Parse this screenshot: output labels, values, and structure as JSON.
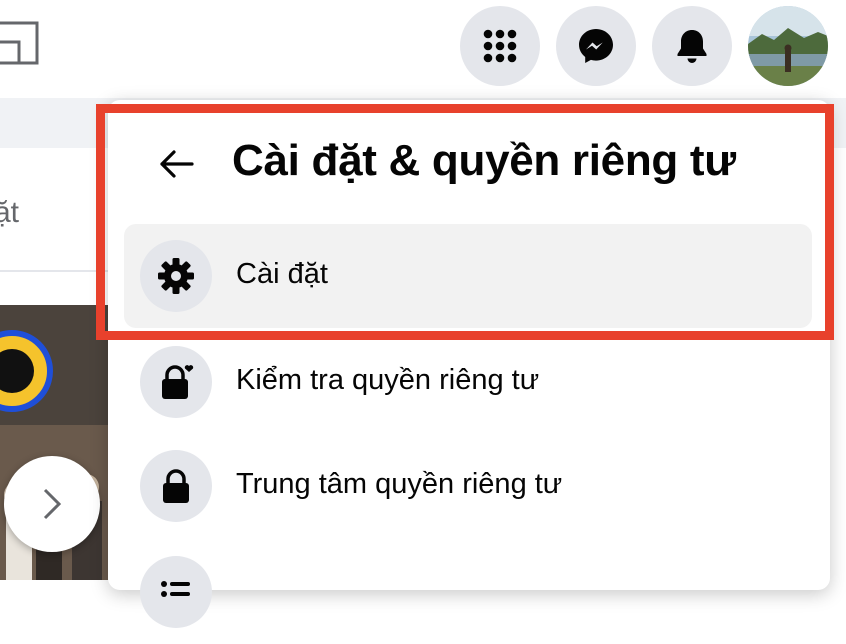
{
  "topbar": {
    "left_icon": "window-outline-icon",
    "buttons": [
      {
        "icon": "menu-grid-icon"
      },
      {
        "icon": "messenger-icon"
      },
      {
        "icon": "bell-icon"
      }
    ],
    "avatar": "profile-avatar"
  },
  "background": {
    "partial_text": "ặt"
  },
  "panel": {
    "back_icon": "arrow-left-icon",
    "title": "Cài đặt & quyền riêng tư",
    "items": [
      {
        "label": "Cài đặt",
        "icon": "gear-icon"
      },
      {
        "label": "Kiểm tra quyền riêng tư",
        "icon": "lock-heart-icon"
      },
      {
        "label": "Trung tâm quyền riêng tư",
        "icon": "lock-icon"
      },
      {
        "label": "",
        "icon": "list-icon"
      }
    ]
  },
  "highlight_color": "#e8412c"
}
